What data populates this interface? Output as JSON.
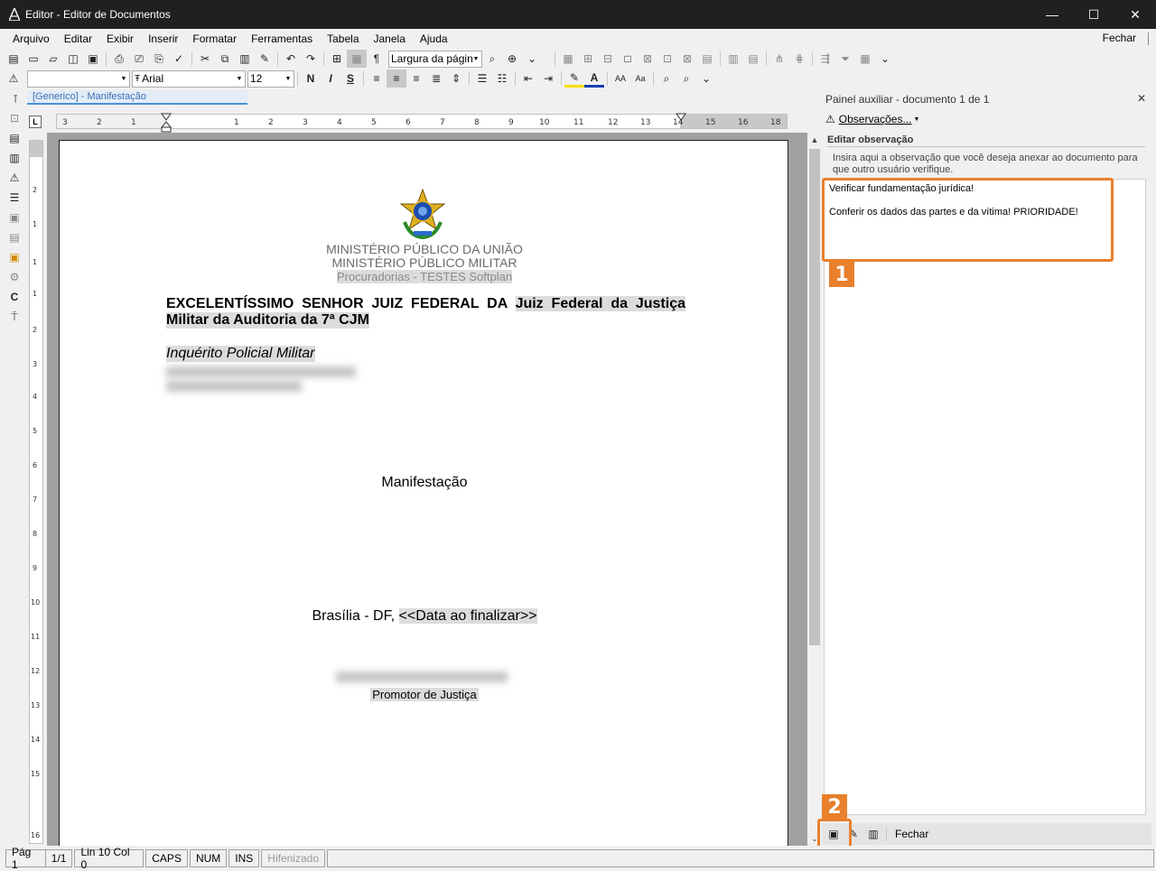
{
  "window": {
    "title": "Editor - Editor de Documentos",
    "minimize": "—",
    "maximize": "☐",
    "close": "✕"
  },
  "menu": {
    "items": [
      "Arquivo",
      "Editar",
      "Exibir",
      "Inserir",
      "Formatar",
      "Ferramentas",
      "Tabela",
      "Janela",
      "Ajuda"
    ],
    "close_label": "Fechar"
  },
  "toolbar": {
    "zoom_value": "Largura da págin",
    "style_value": "",
    "font_value": "Arial",
    "size_value": "12",
    "style_label": "[Generico] - Manifestação"
  },
  "document": {
    "header_line1": "MINISTÉRIO PÚBLICO DA UNIÃO",
    "header_line2": "MINISTÉRIO PÚBLICO MILITAR",
    "header_line3": "Procuradorias - TESTES Softplan",
    "addressee_line1_a": "EXCELENTÍSSIMO SENHOR JUIZ FEDERAL DA",
    "addressee_line1_b": "Juiz Federal da Justiça",
    "addressee_line2": "Militar da Auditoria da 7ª CJM",
    "case_type": "Inquérito Policial Militar",
    "doc_title": "Manifestação",
    "city": "Brasília - DF,",
    "date_field": "<<Data ao finalizar>>",
    "signer_role": "Promotor de Justiça"
  },
  "panel": {
    "title": "Painel auxiliar - documento 1 de 1",
    "close": "✕",
    "observations_button": "Observações...",
    "section_title": "Editar observação",
    "hint": "Insira aqui a observação que você deseja anexar ao documento para que outro usuário verifique.",
    "note_line1": "Verificar fundamentação jurídica!",
    "note_line2": "Conferir os dados das partes e da vítima! PRIORIDADE!",
    "close_button": "Fechar",
    "callout1": "1",
    "callout2": "2"
  },
  "status": {
    "page": "Pág 1",
    "pages": "1/1",
    "position": "Lin 10  Col 0",
    "caps": "CAPS",
    "num": "NUM",
    "ins": "INS",
    "hyphen": "Hifenizado"
  },
  "colors": {
    "callout": "#e8802c",
    "titlebar": "#202020",
    "style_label": "#3d6fb5"
  }
}
